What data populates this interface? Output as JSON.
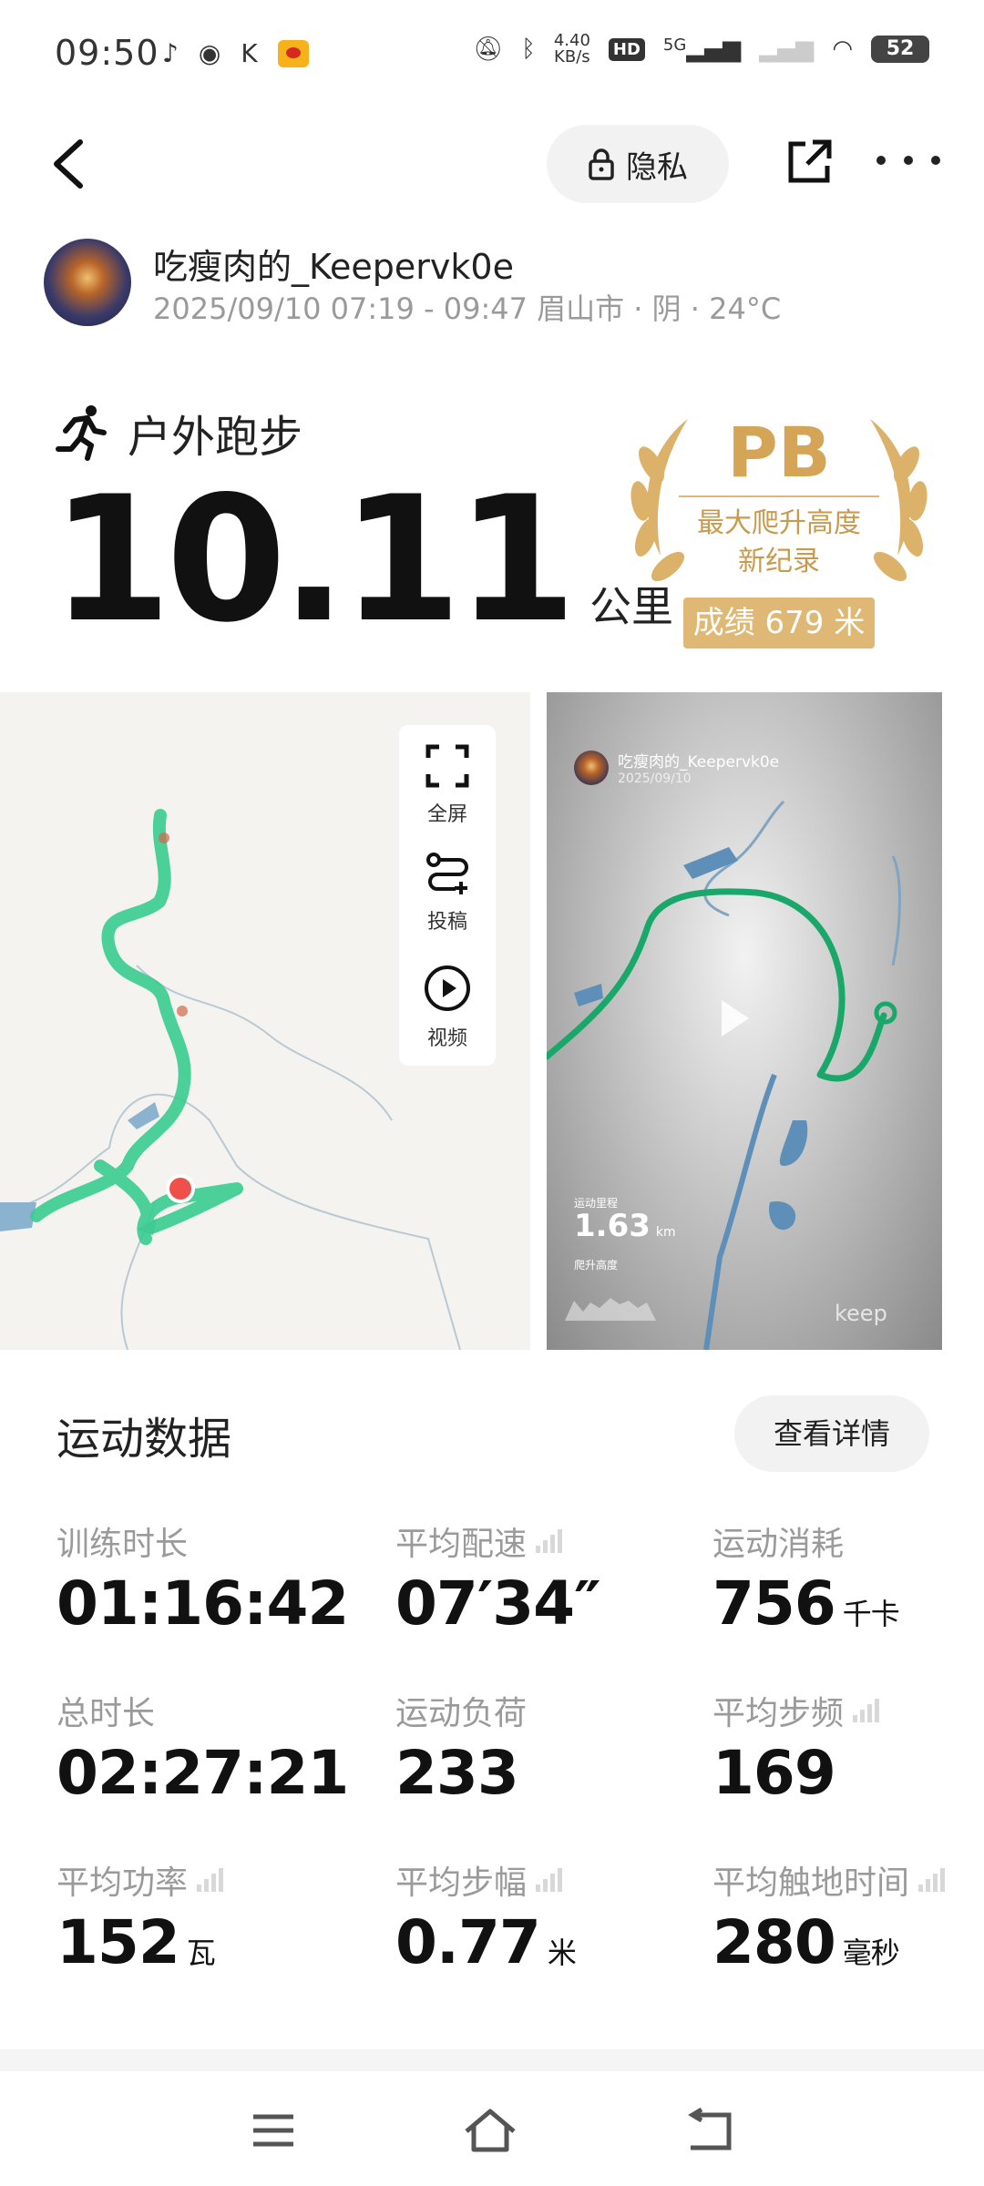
{
  "status_bar": {
    "time": "09:50",
    "net_speed_value": "4.40",
    "net_speed_unit": "KB/s",
    "hd_label": "HD",
    "signal_label": "5G",
    "battery": "52"
  },
  "header": {
    "privacy_label": "隐私",
    "back_icon": "back-arrow-icon",
    "share_icon": "share-icon",
    "more_icon": "more-icon"
  },
  "user": {
    "name": "吃瘦肉的_Keepervk0e",
    "meta": "2025/09/10 07:19 - 09:47 眉山市 · 阴 · 24°C"
  },
  "activity": {
    "type": "户外跑步",
    "distance": "10.11",
    "unit": "公里"
  },
  "pb_badge": {
    "title": "PB",
    "line1": "最大爬升高度",
    "line2": "新纪录",
    "score": "成绩 679 米",
    "color": "#d5a557"
  },
  "map_tools": {
    "fullscreen": "全屏",
    "submit": "投稿",
    "video": "视频"
  },
  "video_preview": {
    "user": "吃瘦肉的_Keepervk0e",
    "date": "2025/09/10",
    "distance_label": "运动里程",
    "distance": "1.63",
    "distance_unit": "km",
    "elevation_label": "爬升高度",
    "logo": "keep"
  },
  "stats": {
    "title": "运动数据",
    "details_button": "查看详情",
    "items": [
      {
        "label": "训练时长",
        "value": "01:16:42",
        "unit": ""
      },
      {
        "label": "平均配速",
        "value": "07′34″",
        "unit": ""
      },
      {
        "label": "运动消耗",
        "value": "756",
        "unit": "千卡"
      },
      {
        "label": "总时长",
        "value": "02:27:21",
        "unit": ""
      },
      {
        "label": "运动负荷",
        "value": "233",
        "unit": ""
      },
      {
        "label": "平均步频",
        "value": "169",
        "unit": ""
      },
      {
        "label": "平均功率",
        "value": "152",
        "unit": "瓦"
      },
      {
        "label": "平均步幅",
        "value": "0.77",
        "unit": "米"
      },
      {
        "label": "平均触地时间",
        "value": "280",
        "unit": "毫秒"
      }
    ]
  },
  "colors": {
    "route": "#2ecc8a",
    "video_route": "#1aa86a",
    "start_marker": "#f0504a",
    "accent_gold": "#dfb876"
  }
}
